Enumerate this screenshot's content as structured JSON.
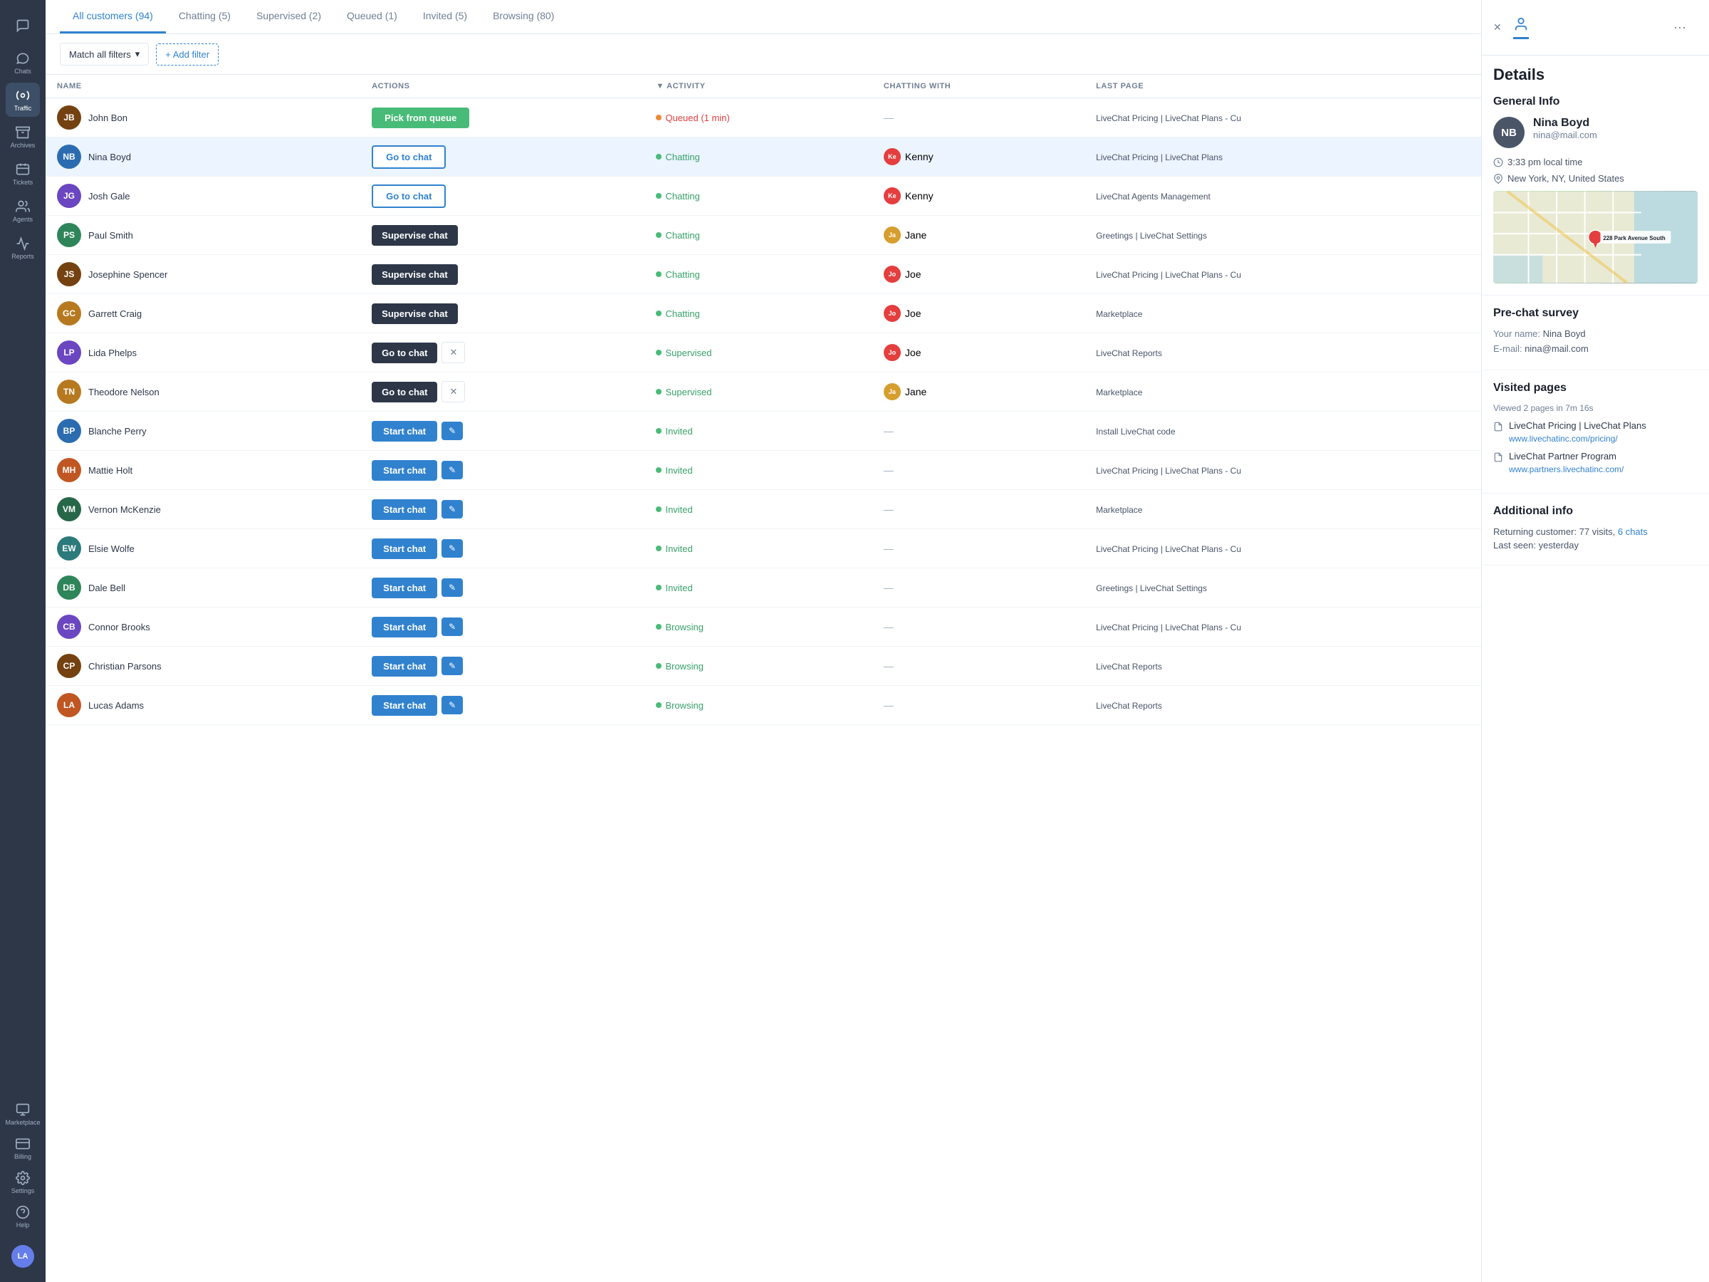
{
  "sidebar": {
    "items": [
      {
        "id": "chat-bubble",
        "label": "",
        "icon": "chat",
        "active": false
      },
      {
        "id": "chats",
        "label": "Chats",
        "active": false
      },
      {
        "id": "traffic",
        "label": "Traffic",
        "active": true
      },
      {
        "id": "archives",
        "label": "Archives",
        "active": false
      },
      {
        "id": "tickets",
        "label": "Tickets",
        "active": false
      },
      {
        "id": "agents",
        "label": "Agents",
        "active": false
      },
      {
        "id": "reports",
        "label": "Reports",
        "active": false
      },
      {
        "id": "marketplace",
        "label": "Marketplace",
        "active": false
      },
      {
        "id": "billing",
        "label": "Billing",
        "active": false
      },
      {
        "id": "settings",
        "label": "Settings",
        "active": false
      },
      {
        "id": "help",
        "label": "Help",
        "active": false
      }
    ],
    "user_initials": "LA"
  },
  "tabs": [
    {
      "label": "All customers (94)",
      "active": true
    },
    {
      "label": "Chatting (5)",
      "active": false
    },
    {
      "label": "Supervised (2)",
      "active": false
    },
    {
      "label": "Queued (1)",
      "active": false
    },
    {
      "label": "Invited (5)",
      "active": false
    },
    {
      "label": "Browsing (80)",
      "active": false
    }
  ],
  "toolbar": {
    "filter_label": "Match all filters",
    "add_filter_label": "+ Add filter"
  },
  "table": {
    "columns": [
      "NAME",
      "ACTIONS",
      "ACTIVITY",
      "CHATTING WITH",
      "LAST PAGE"
    ],
    "rows": [
      {
        "initials": "JB",
        "color": "#744210",
        "name": "John Bon",
        "action_type": "pick_queue",
        "action_label": "Pick from queue",
        "activity_dot": "orange",
        "activity_label": "Queued (1 min)",
        "activity_color": "#e53e3e",
        "chatting_with": "",
        "last_page": "LiveChat Pricing | LiveChat Plans - Cu"
      },
      {
        "initials": "NB",
        "color": "#2b6cb0",
        "name": "Nina Boyd",
        "action_type": "go_chat",
        "action_label": "Go to chat",
        "activity_dot": "green",
        "activity_label": "Chatting",
        "activity_color": "#38a169",
        "chatting_with": "Kenny",
        "chatting_color": "#e53e3e",
        "last_page": "LiveChat Pricing | LiveChat Plans",
        "selected": true
      },
      {
        "initials": "JG",
        "color": "#6b46c1",
        "name": "Josh Gale",
        "action_type": "go_chat",
        "action_label": "Go to chat",
        "activity_dot": "green",
        "activity_label": "Chatting",
        "activity_color": "#38a169",
        "chatting_with": "Kenny",
        "chatting_color": "#e53e3e",
        "last_page": "LiveChat Agents Management"
      },
      {
        "initials": "PS",
        "color": "#2f855a",
        "name": "Paul Smith",
        "action_type": "supervise",
        "action_label": "Supervise chat",
        "activity_dot": "green",
        "activity_label": "Chatting",
        "activity_color": "#38a169",
        "chatting_with": "Jane",
        "chatting_color": "#d69e2e",
        "last_page": "Greetings | LiveChat Settings"
      },
      {
        "initials": "JS",
        "color": "#744210",
        "name": "Josephine Spencer",
        "action_type": "supervise",
        "action_label": "Supervise chat",
        "activity_dot": "green",
        "activity_label": "Chatting",
        "activity_color": "#38a169",
        "chatting_with": "Joe",
        "chatting_color": "#e53e3e",
        "last_page": "LiveChat Pricing | LiveChat Plans - Cu",
        "annotated": true
      },
      {
        "initials": "GC",
        "color": "#b7791f",
        "name": "Garrett Craig",
        "action_type": "supervise",
        "action_label": "Supervise chat",
        "activity_dot": "green",
        "activity_label": "Chatting",
        "activity_color": "#38a169",
        "chatting_with": "Joe",
        "chatting_color": "#e53e3e",
        "last_page": "Marketplace"
      },
      {
        "initials": "LP",
        "color": "#6b46c1",
        "name": "Lida Phelps",
        "action_type": "go_chat_x",
        "action_label": "Go to chat",
        "activity_dot": "green",
        "activity_label": "Supervised",
        "activity_color": "#38a169",
        "chatting_with": "Joe",
        "chatting_color": "#e53e3e",
        "last_page": "LiveChat Reports"
      },
      {
        "initials": "TN",
        "color": "#b7791f",
        "name": "Theodore Nelson",
        "action_type": "go_chat_x",
        "action_label": "Go to chat",
        "activity_dot": "green",
        "activity_label": "Supervised",
        "activity_color": "#38a169",
        "chatting_with": "Jane",
        "chatting_color": "#d69e2e",
        "last_page": "Marketplace"
      },
      {
        "initials": "BP",
        "color": "#2b6cb0",
        "name": "Blanche Perry",
        "action_type": "start_chat",
        "action_label": "Start chat",
        "activity_dot": "green",
        "activity_label": "Invited",
        "activity_color": "#38a169",
        "chatting_with": "",
        "last_page": "Install LiveChat code"
      },
      {
        "initials": "MH",
        "color": "#c05621",
        "name": "Mattie Holt",
        "action_type": "start_chat",
        "action_label": "Start chat",
        "activity_dot": "green",
        "activity_label": "Invited",
        "activity_color": "#38a169",
        "chatting_with": "",
        "last_page": "LiveChat Pricing | LiveChat Plans - Cu"
      },
      {
        "initials": "VM",
        "color": "#276749",
        "name": "Vernon McKenzie",
        "action_type": "start_chat",
        "action_label": "Start chat",
        "activity_dot": "green",
        "activity_label": "Invited",
        "activity_color": "#38a169",
        "chatting_with": "",
        "last_page": "Marketplace"
      },
      {
        "initials": "EW",
        "color": "#2c7a7b",
        "name": "Elsie Wolfe",
        "action_type": "start_chat",
        "action_label": "Start chat",
        "activity_dot": "green",
        "activity_label": "Invited",
        "activity_color": "#38a169",
        "chatting_with": "",
        "last_page": "LiveChat Pricing | LiveChat Plans - Cu"
      },
      {
        "initials": "DB",
        "color": "#2f855a",
        "name": "Dale Bell",
        "action_type": "start_chat",
        "action_label": "Start chat",
        "activity_dot": "green",
        "activity_label": "Invited",
        "activity_color": "#38a169",
        "chatting_with": "",
        "last_page": "Greetings | LiveChat Settings"
      },
      {
        "initials": "CB",
        "color": "#6b46c1",
        "name": "Connor Brooks",
        "action_type": "start_chat",
        "action_label": "Start chat",
        "activity_dot": "green",
        "activity_label": "Browsing",
        "activity_color": "#38a169",
        "chatting_with": "",
        "last_page": "LiveChat Pricing | LiveChat Plans - Cu"
      },
      {
        "initials": "CP",
        "color": "#744210",
        "name": "Christian Parsons",
        "action_type": "start_chat",
        "action_label": "Start chat",
        "activity_dot": "green",
        "activity_label": "Browsing",
        "activity_color": "#38a169",
        "chatting_with": "",
        "last_page": "LiveChat Reports"
      },
      {
        "initials": "LA",
        "color": "#c05621",
        "name": "Lucas Adams",
        "action_type": "start_chat",
        "action_label": "Start chat",
        "activity_dot": "green",
        "activity_label": "Browsing",
        "activity_color": "#38a169",
        "chatting_with": "",
        "last_page": "LiveChat Reports"
      }
    ]
  },
  "detail_panel": {
    "title": "Details",
    "more_label": "···",
    "general_info": {
      "title": "General Info",
      "name": "Nina Boyd",
      "email": "nina@mail.com",
      "local_time": "3:33 pm local time",
      "location": "New York, NY, United States",
      "map_address": "228 Park Avenue South"
    },
    "pre_chat": {
      "title": "Pre-chat survey",
      "name_label": "Your name:",
      "name_value": "Nina Boyd",
      "email_label": "E-mail:",
      "email_value": "nina@mail.com"
    },
    "visited": {
      "title": "Visited pages",
      "summary": "Viewed 2 pages in 7m 16s",
      "pages": [
        {
          "title": "LiveChat Pricing | LiveChat Plans",
          "url": "www.livechatinc.com/pricing/"
        },
        {
          "title": "LiveChat Partner Program",
          "url": "www.partners.livechatinc.com/"
        }
      ]
    },
    "additional": {
      "title": "Additional info",
      "returning": "Returning customer: 77 visits,",
      "chats": "6 chats",
      "last_seen": "Last seen: yesterday"
    }
  }
}
